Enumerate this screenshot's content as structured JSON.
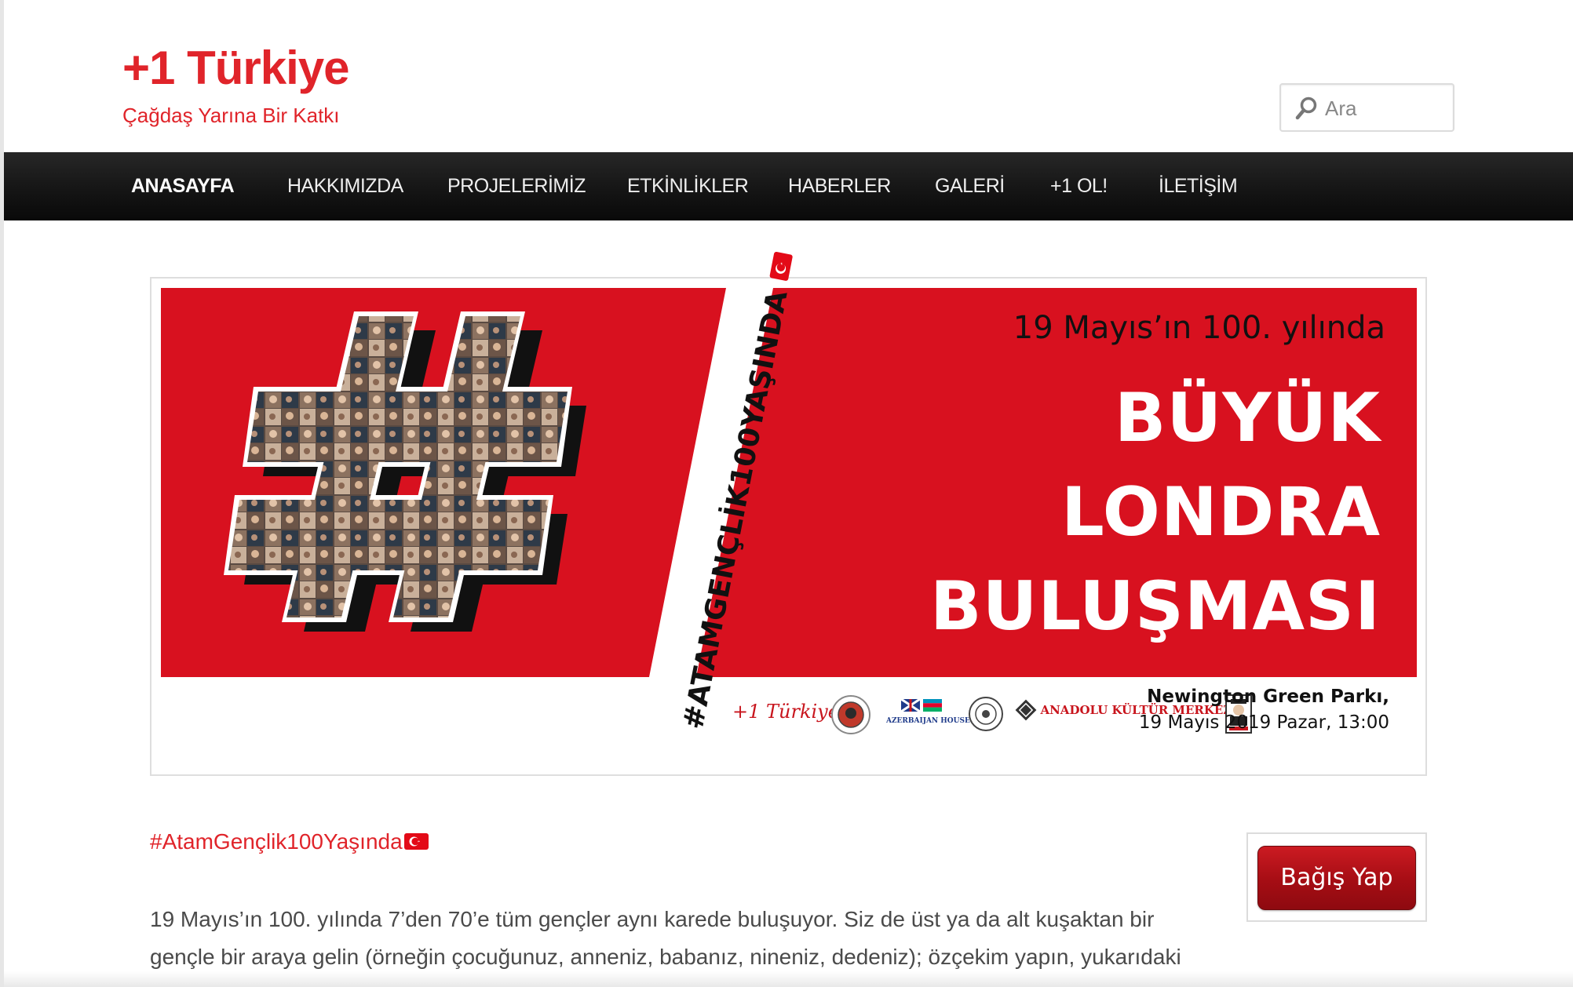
{
  "site": {
    "title": "+1 Türkiye",
    "tagline": "Çağdaş Yarına Bir Katkı"
  },
  "search": {
    "placeholder": "Ara",
    "icon": "search-icon"
  },
  "nav": {
    "items": [
      {
        "label": "ANASAYFA",
        "active": true
      },
      {
        "label": "HAKKIMIZDA",
        "active": false
      },
      {
        "label": "PROJELERİMİZ",
        "active": false
      },
      {
        "label": "ETKİNLİKLER",
        "active": false
      },
      {
        "label": "HABERLER",
        "active": false
      },
      {
        "label": "GALERİ",
        "active": false
      },
      {
        "label": "+1 OL!",
        "active": false
      },
      {
        "label": "İLETİŞİM",
        "active": false
      }
    ]
  },
  "banner": {
    "subtitle": "19 Mayıs’ın 100. yılında",
    "title_lines": [
      "BÜYÜK",
      "LONDRA",
      "BULUŞMASI"
    ],
    "hashtag": "#ATAMGENÇLİK100YAŞINDA",
    "venue": "Newington Green Parkı,",
    "datetime": "19 Mayıs 2019 Pazar, 13:00",
    "logos": [
      "+1 Türkiye",
      "seal-logo",
      "AZERBAIJAN HOUSE",
      "emblem-logo",
      "ANADOLU KÜLTÜR MERKEZİ",
      "portrait-logo"
    ]
  },
  "content": {
    "hashtag": "#AtamGençlik100Yaşında",
    "paragraph_lines": [
      "19 Mayıs’ın 100. yılında 7’den 70’e tüm gençler aynı karede buluşuyor. Siz de üst ya da alt kuşaktan bir",
      "gençle bir araya gelin (örneğin çocuğunuz, anneniz, babanız, nineniz, dedeniz); özçekim yapın, yukarıdaki"
    ]
  },
  "donate": {
    "label": "Bağış Yap"
  },
  "colors": {
    "brand_red": "#e0242a",
    "banner_red": "#d8111f",
    "nav_bg": "#141414",
    "donate_red": "#a50d14"
  }
}
